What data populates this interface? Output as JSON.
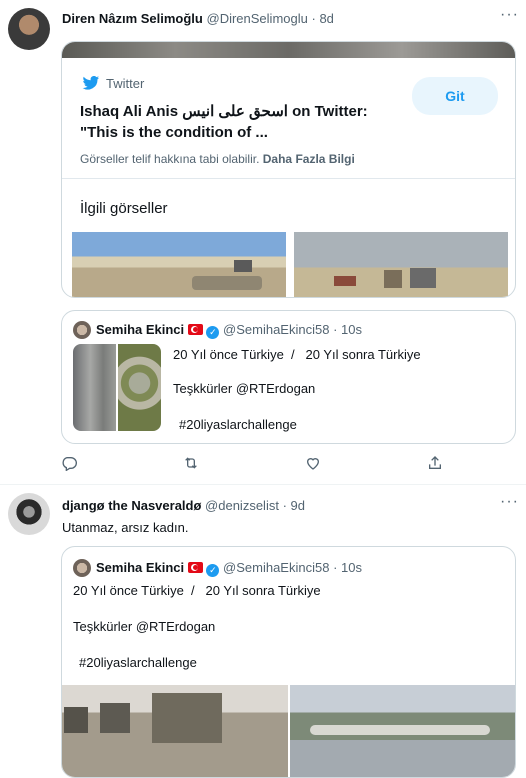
{
  "tweet1": {
    "name": "Diren Nâzım Selimoğlu",
    "handle": "@DirenSelimoglu",
    "time": "8d",
    "card": {
      "source": "Twitter",
      "title_line1": "Ishaq Ali Anis اسحق علی انیس on Twitter:",
      "title_line2": "\"This is the condition of ...",
      "button": "Git",
      "notice": "Görseller telif hakkına tabi olabilir.",
      "more_info": "Daha Fazla Bilgi",
      "related": "İlgili görseller"
    },
    "quote": {
      "name": "Semiha Ekinci",
      "handle": "@SemihaEkinci58",
      "time": "10s",
      "line1": "20 Yıl önce Türkiye  /   20 Yıl sonra Türkiye",
      "line2": "Teşkkürler @RTErdogan",
      "line3": "#20liyaslarchallenge"
    }
  },
  "tweet2": {
    "name": "djangø the Nasveraldø",
    "handle": "@denizselist",
    "time": "9d",
    "text": "Utanmaz, arsız kadın.",
    "quote": {
      "name": "Semiha Ekinci",
      "handle": "@SemihaEkinci58",
      "time": "10s",
      "line1": "20 Yıl önce Türkiye  /   20 Yıl sonra Türkiye",
      "line2": "Teşkkürler @RTErdogan",
      "line3": "#20liyaslarchallenge"
    }
  },
  "icons": [
    "more-icon",
    "twitter-bird-icon",
    "reply-icon",
    "retweet-icon",
    "like-icon",
    "share-icon",
    "verified-icon",
    "turkish-flag-icon"
  ]
}
